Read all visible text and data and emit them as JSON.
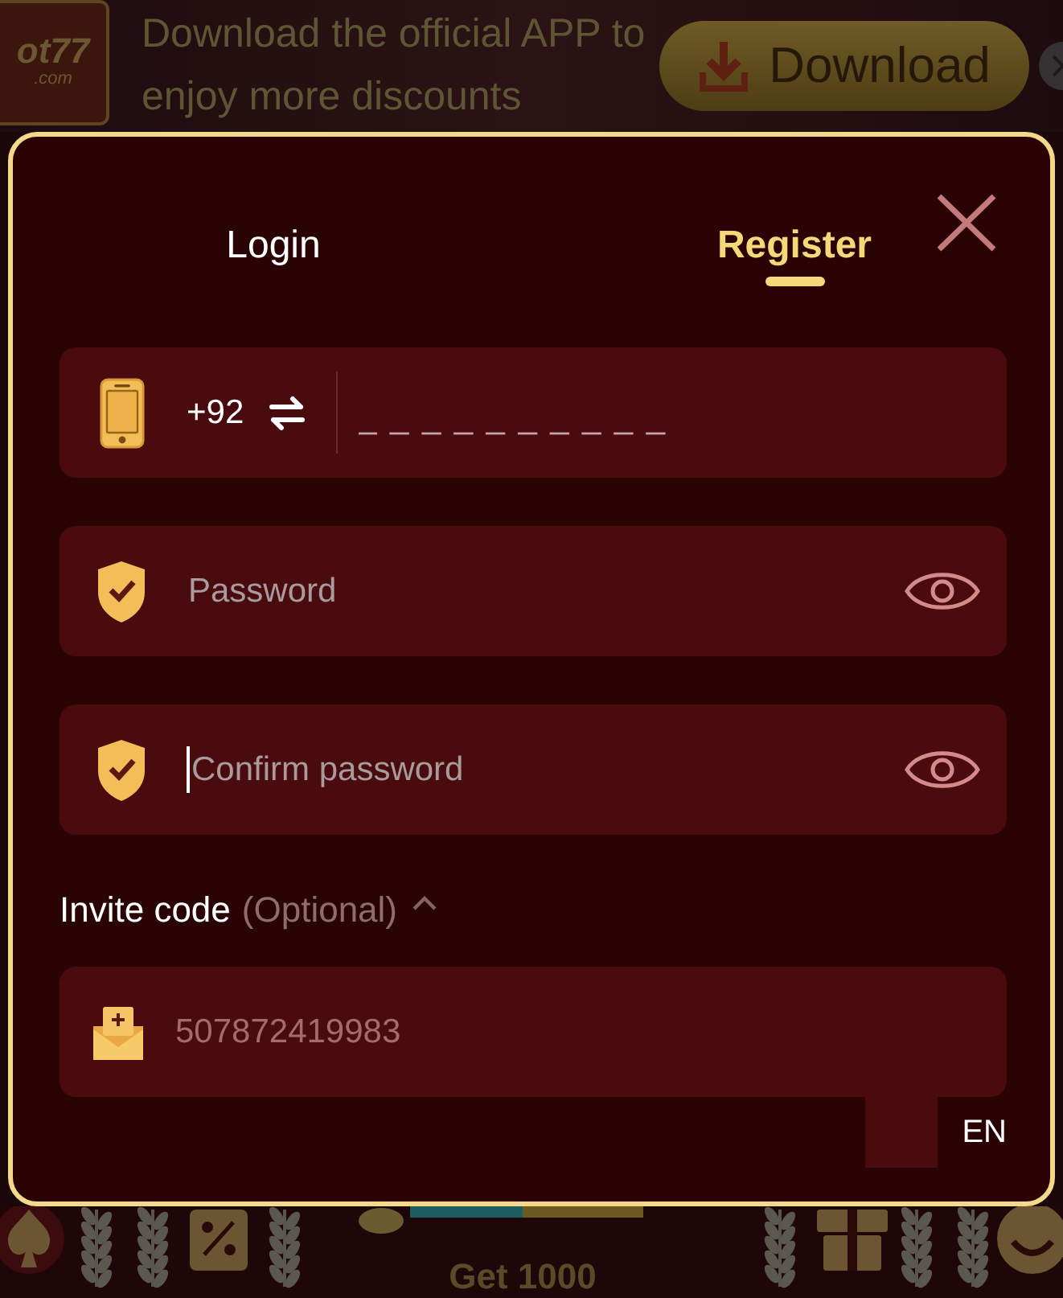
{
  "banner": {
    "logo_text": "ot77",
    "logo_subtext": ".com",
    "message": "Download the official APP to enjoy more discounts",
    "download_button": "Download"
  },
  "dialog": {
    "tabs": [
      {
        "label": "Login",
        "selected": false
      },
      {
        "label": "Register",
        "selected": true
      }
    ],
    "fields": [
      {
        "kind": "phone",
        "country_code": "+92",
        "placeholder": "_ _ _ _ _ _ _ _ _ _",
        "focused": false
      },
      {
        "kind": "password",
        "placeholder": "Password",
        "focused": false
      },
      {
        "kind": "password",
        "placeholder": "Confirm password",
        "focused": true
      }
    ],
    "invite": {
      "label": "Invite code",
      "hint": "(Optional)",
      "expanded": true,
      "value": "507872419983"
    },
    "language": "EN"
  },
  "bottom_nav": {
    "promo_text": "Get 1000"
  }
}
